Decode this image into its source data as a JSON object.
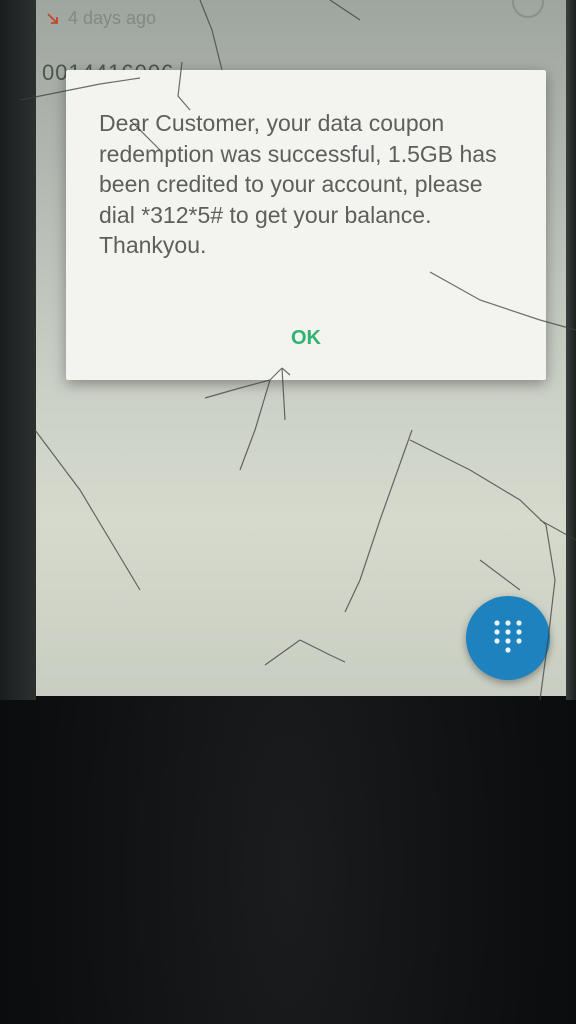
{
  "call_log": {
    "time_ago": "4 days ago",
    "number_partial": "0014416006"
  },
  "dialog": {
    "message": "Dear Customer, your data coupon redemption was successful, 1.5GB has been credited to your account, please dial *312*5# to get your balance. Thankyou.",
    "ok_label": "OK"
  },
  "icons": {
    "missed_call": "missed-call-arrow-icon",
    "dialpad": "dialpad-icon"
  },
  "colors": {
    "accent_ok": "#2fb36f",
    "fab": "#1d82be",
    "missed_call": "#c2452c"
  }
}
